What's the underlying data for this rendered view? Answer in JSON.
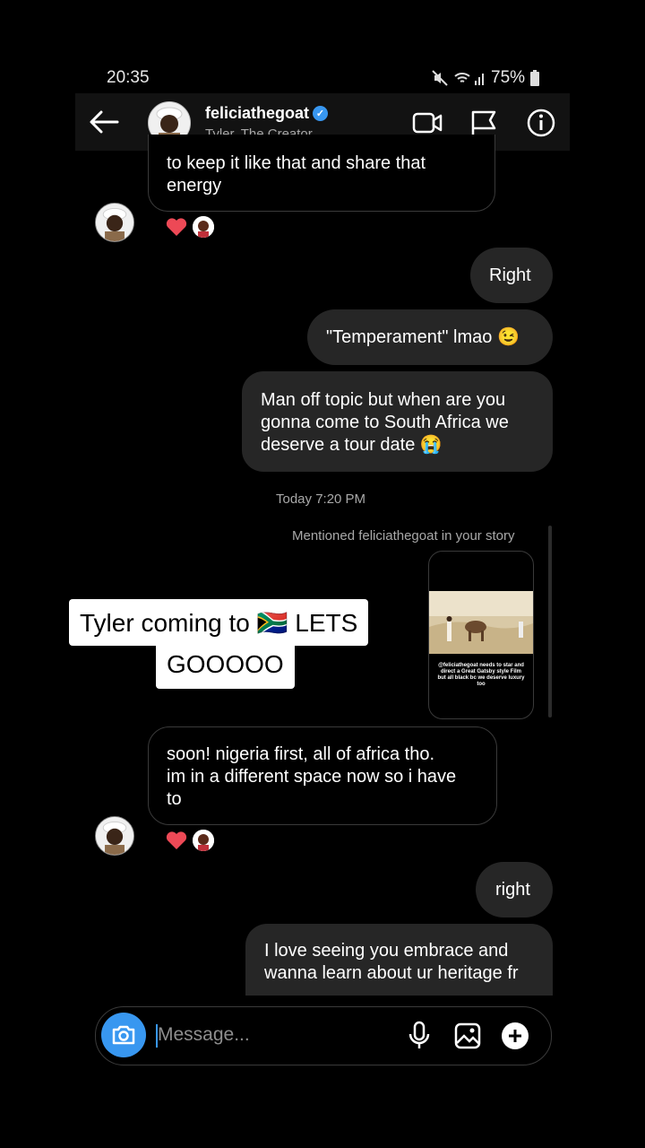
{
  "status": {
    "time": "20:35",
    "battery": "75%"
  },
  "header": {
    "username": "feliciathegoat",
    "subtitle": "Tyler, The Creator"
  },
  "messages": {
    "m1_line1": "to keep it like that and share that",
    "m1_line2": "energy",
    "m2": "Right",
    "m3": "\"Temperament\" lmao 😉",
    "m4_line1": "Man off topic but when are you",
    "m4_line2": "gonna come to South Africa we",
    "m4_line3": "deserve a tour date 😭",
    "timestamp": "Today 7:20 PM",
    "mention": "Mentioned feliciathegoat in your story",
    "story_caption": "@feliciathegoat needs to star and direct a Great Gatsby style Film but all black bc we deserve luxury too",
    "m5_line1": "soon! nigeria first, all of africa tho.",
    "m5_line2": "im in a different space now so i have",
    "m5_line3": "to",
    "m6": "right",
    "m7_line1": "I love seeing you embrace and",
    "m7_line2": "wanna learn about ur heritage fr"
  },
  "overlay": {
    "line1": "Tyler coming to 🇿🇦 LETS",
    "line2": "GOOOOO"
  },
  "composer": {
    "placeholder": "Message..."
  },
  "colors": {
    "accent": "#3897f0",
    "heart": "#ed4956",
    "bubble": "#262626"
  },
  "icons": [
    "back-arrow-icon",
    "verified-icon",
    "video-call-icon",
    "flag-icon",
    "info-icon",
    "heart-icon",
    "camera-icon",
    "microphone-icon",
    "gallery-icon",
    "plus-icon"
  ]
}
